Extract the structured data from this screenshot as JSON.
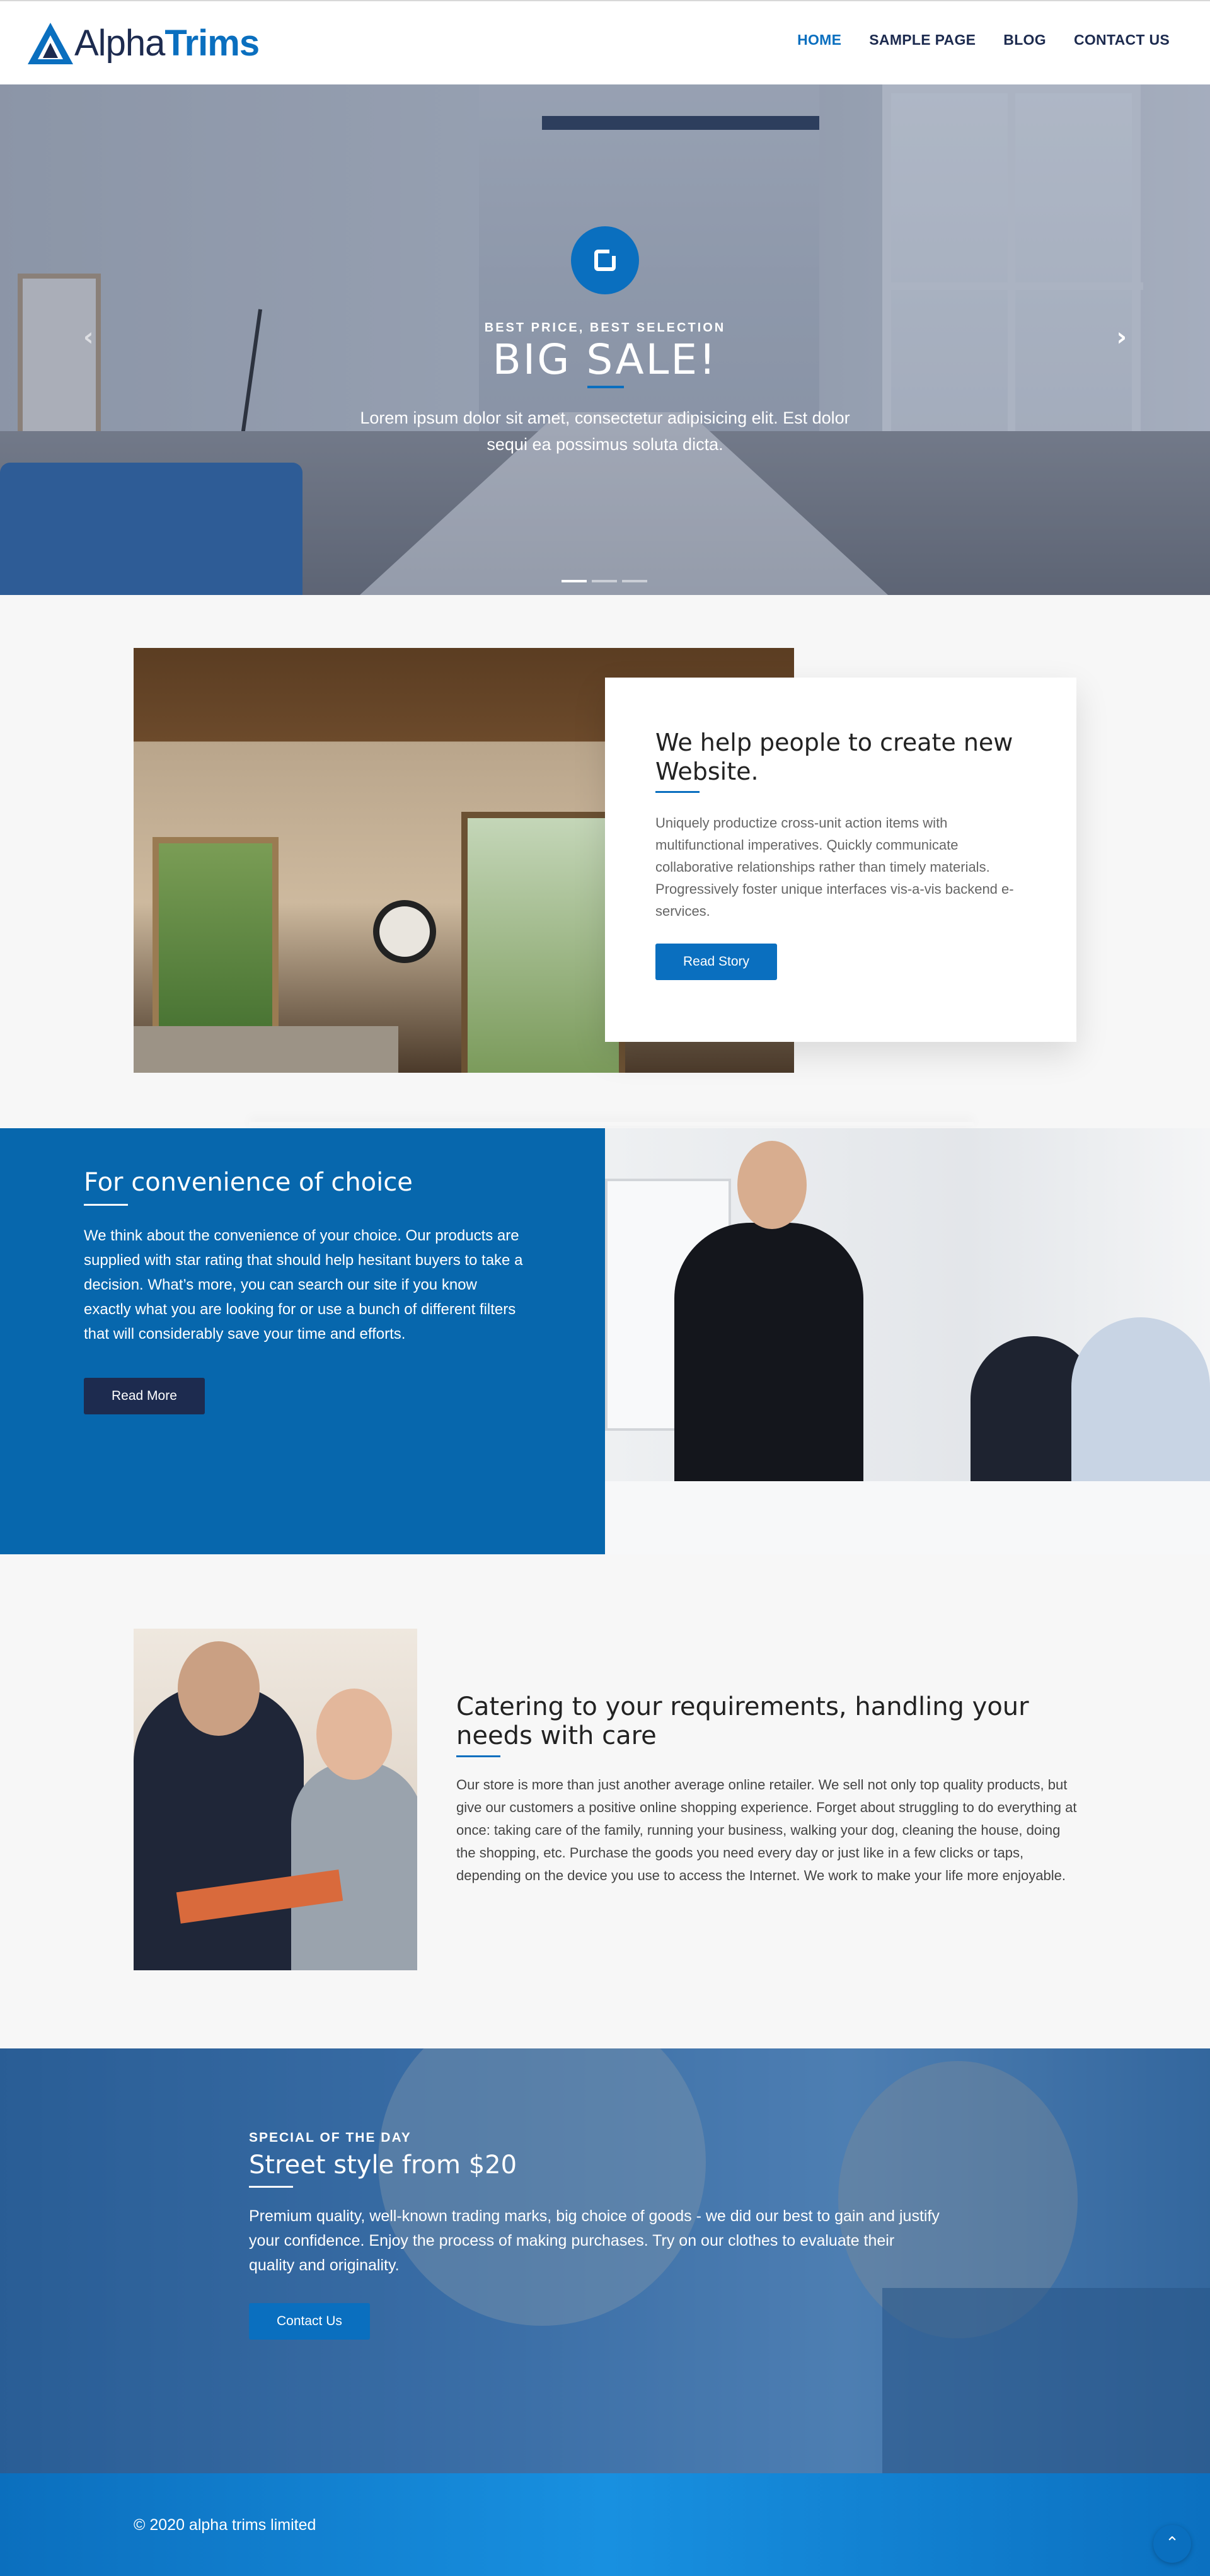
{
  "brand": {
    "name_part1": "Alpha",
    "name_part2": "Trims",
    "accent": "#0a6fbf",
    "dark": "#1d2b4f"
  },
  "nav": {
    "items": [
      {
        "label": "HOME",
        "active": true
      },
      {
        "label": "SAMPLE PAGE",
        "active": false
      },
      {
        "label": "BLOG",
        "active": false
      },
      {
        "label": "CONTACT US",
        "active": false
      }
    ]
  },
  "hero": {
    "kicker": "BEST PRICE, BEST SELECTION",
    "title": "BIG SALE!",
    "text": "Lorem ipsum dolor sit amet, consectetur adipisicing elit. Est dolor sequi ea possimus soluta dicta.",
    "prev_icon": "chevron-left-icon",
    "next_icon": "chevron-right-icon",
    "slides": 3,
    "active_slide": 1
  },
  "story": {
    "title": "We help people to create new Website.",
    "text": "Uniquely productize cross-unit action items with multifunctional imperatives. Quickly communicate collaborative relationships rather than timely materials. Progressively foster unique interfaces vis-a-vis backend e-services.",
    "button": "Read Story"
  },
  "convenience": {
    "title": "For convenience of choice",
    "text": "We think about the convenience of your choice. Our products are supplied with star rating that should help hesitant buyers to take a decision. What’s more, you can search our site if you know exactly what you are looking for or use a bunch of different filters that will considerably save your time and efforts.",
    "button": "Read More"
  },
  "catering": {
    "title": "Catering to your requirements, handling your needs with care",
    "text": "Our store is more than just another average online retailer. We sell not only top quality products, but give our customers a positive online shopping experience. Forget about struggling to do everything at once: taking care of the family, running your business, walking your dog, cleaning the house, doing the shopping, etc. Purchase the goods you need every day or just like in a few clicks or taps, depending on the device you use to access the Internet. We work to make your life more enjoyable."
  },
  "special": {
    "kicker": "SPECIAL OF THE DAY",
    "title": "Street style from $20",
    "text": "Premium quality, well-known trading marks, big choice of goods - we did our best to gain and justify your confidence. Enjoy the process of making purchases. Try on our clothes to evaluate their quality and originality.",
    "button": "Contact Us"
  },
  "footer": {
    "copyright": "© 2020 alpha trims limited",
    "to_top_icon": "double-chevron-up-icon"
  }
}
